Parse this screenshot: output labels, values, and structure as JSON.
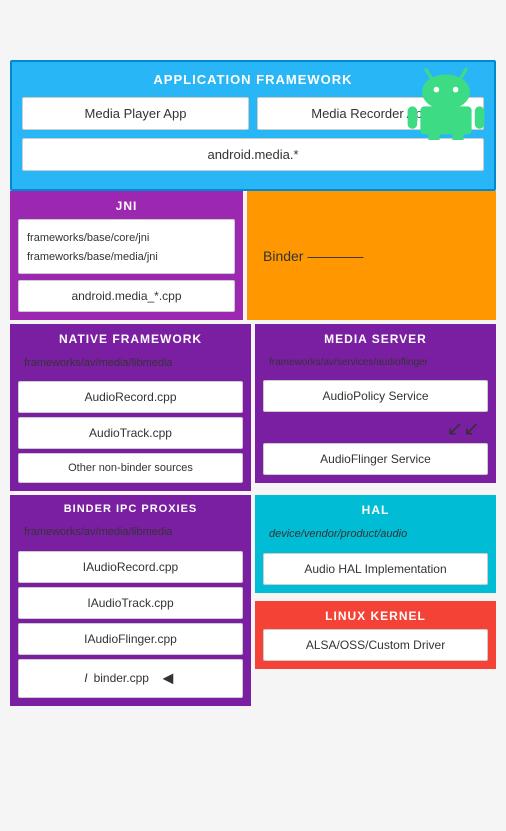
{
  "android_robot": {
    "alt": "Android Robot"
  },
  "app_framework": {
    "title": "APPLICATION FRAMEWORK",
    "media_player": "Media Player App",
    "media_recorder": "Media Recorder App",
    "android_media": "android.media.*"
  },
  "jni": {
    "title": "JNI",
    "frameworks_core": "frameworks/base/core/jni\nframeworks/base/media/jni",
    "android_media_cpp": "android.media_*.cpp"
  },
  "binder": {
    "label": "Binder"
  },
  "native_framework": {
    "title": "NATIVE FRAMEWORK",
    "path": "frameworks/av/media/libmedia",
    "items": [
      "AudioRecord.cpp",
      "AudioTrack.cpp",
      "Other non-binder sources"
    ]
  },
  "media_server": {
    "title": "MEDIA SERVER",
    "path": "frameworks/av/services/audioflinger",
    "items": [
      "AudioPolicy Service",
      "AudioFlinger Service"
    ]
  },
  "binder_ipc": {
    "title": "BINDER IPC PROXIES",
    "path": "frameworks/av/media/libmedia",
    "items": [
      "IAudioRecord.cpp",
      "IAudioTrack.cpp",
      "IAudioFlinger.cpp",
      "Ibinder.cpp"
    ]
  },
  "hal": {
    "title": "HAL",
    "path": "device/vendor/product/audio",
    "item": "Audio HAL Implementation"
  },
  "linux_kernel": {
    "title": "LINUX KERNEL",
    "item": "ALSA/OSS/Custom Driver"
  }
}
